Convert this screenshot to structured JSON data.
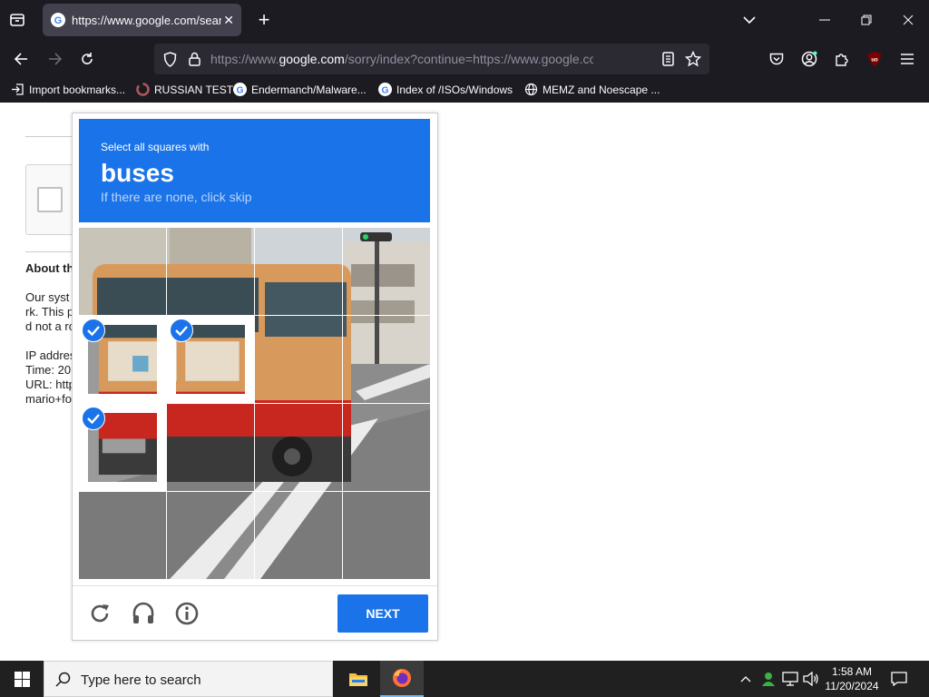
{
  "browser": {
    "tab_title": "https://www.google.com/search",
    "url_prefix": "https://www.",
    "url_domain": "google.com",
    "url_rest": "/sorry/index?continue=https://www.google.com/search",
    "bookmarks": [
      "Import bookmarks...",
      "RUSSIAN TEST",
      "Endermanch/Malware...",
      "Index of /ISOs/Windows",
      "MEMZ and Noescape ..."
    ],
    "ublock_label": "uo"
  },
  "page": {
    "about_heading": "About th",
    "body_lines": [
      "Our syst",
      "rk. This p",
      "d not a ro",
      "",
      "IP addres",
      "Time: 20",
      "URL: http",
      "mario+fo"
    ]
  },
  "captcha": {
    "instruction": "Select all squares with",
    "target": "buses",
    "hint": "If there are none, click skip",
    "selected_tiles": [
      4,
      5,
      8
    ],
    "next_label": "NEXT"
  },
  "taskbar": {
    "search_placeholder": "Type here to search",
    "time": "1:58 AM",
    "date": "11/20/2024"
  },
  "colors": {
    "accent": "#1a73e8",
    "chrome_bg": "#1c1b22"
  }
}
